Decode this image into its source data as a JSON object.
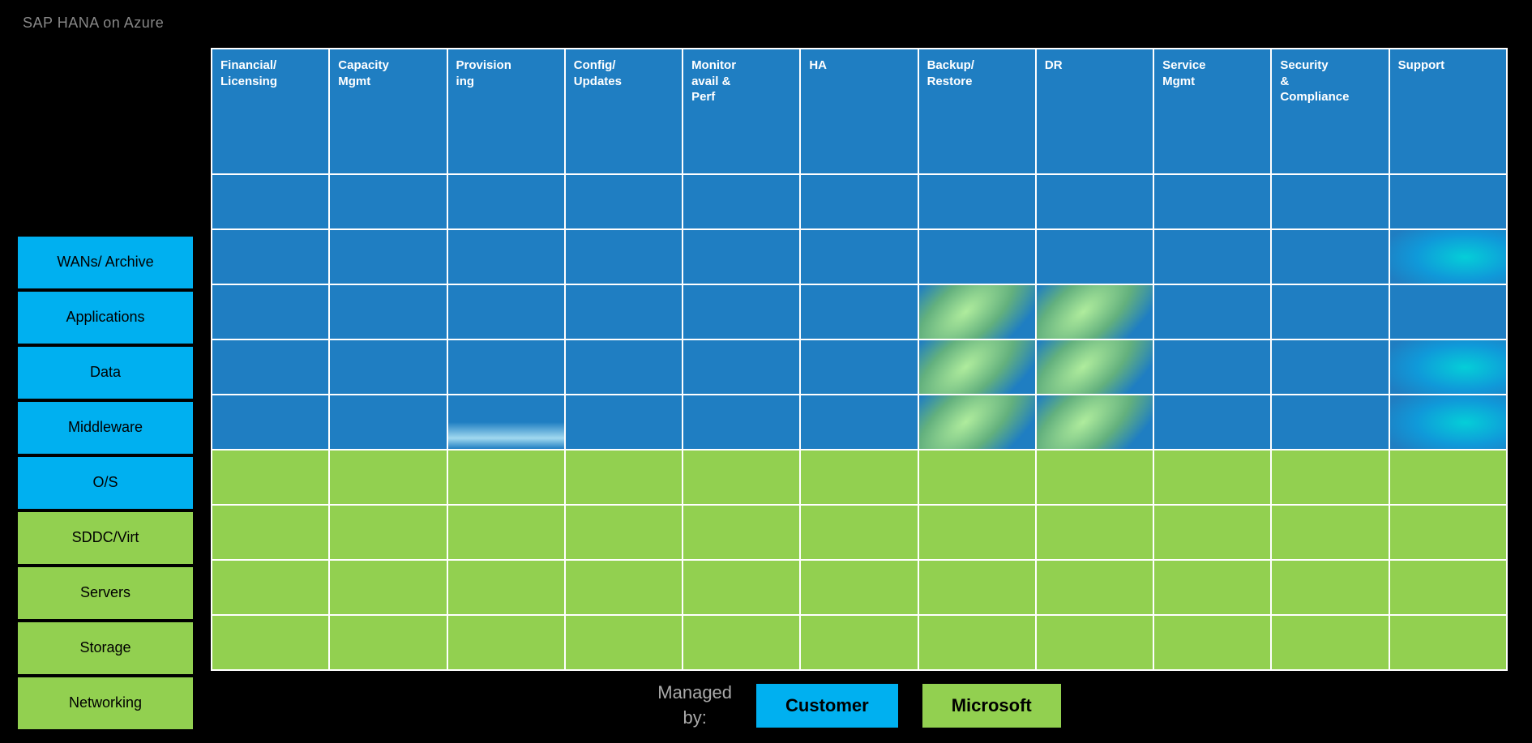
{
  "title": "SAP HANA on Azure",
  "columns": [
    {
      "id": "financial",
      "label": "Financial/\nLicensing"
    },
    {
      "id": "capacity",
      "label": "Capacity\nMgmt"
    },
    {
      "id": "provisioning",
      "label": "Provision\ning"
    },
    {
      "id": "config",
      "label": "Config/\nUpdates"
    },
    {
      "id": "monitor",
      "label": "Monitor\navail &\nPerf"
    },
    {
      "id": "ha",
      "label": "HA"
    },
    {
      "id": "backup",
      "label": "Backup/\nRestore"
    },
    {
      "id": "dr",
      "label": "DR"
    },
    {
      "id": "service",
      "label": "Service\nMgmt"
    },
    {
      "id": "security",
      "label": "Security\n&\nCompliance"
    },
    {
      "id": "support",
      "label": "Support"
    }
  ],
  "rows": [
    {
      "id": "wans",
      "label": "WANs/ Archive",
      "type": "blue"
    },
    {
      "id": "applications",
      "label": "Applications",
      "type": "blue"
    },
    {
      "id": "data",
      "label": "Data",
      "type": "blue"
    },
    {
      "id": "middleware",
      "label": "Middleware",
      "type": "blue"
    },
    {
      "id": "os",
      "label": "O/S",
      "type": "blue"
    },
    {
      "id": "sddc",
      "label": "SDDC/Virt",
      "type": "green"
    },
    {
      "id": "servers",
      "label": "Servers",
      "type": "green"
    },
    {
      "id": "storage",
      "label": "Storage",
      "type": "green"
    },
    {
      "id": "networking",
      "label": "Networking",
      "type": "green"
    }
  ],
  "legend": {
    "managed_by": "Managed\nby:",
    "customer_label": "Customer",
    "microsoft_label": "Microsoft"
  }
}
